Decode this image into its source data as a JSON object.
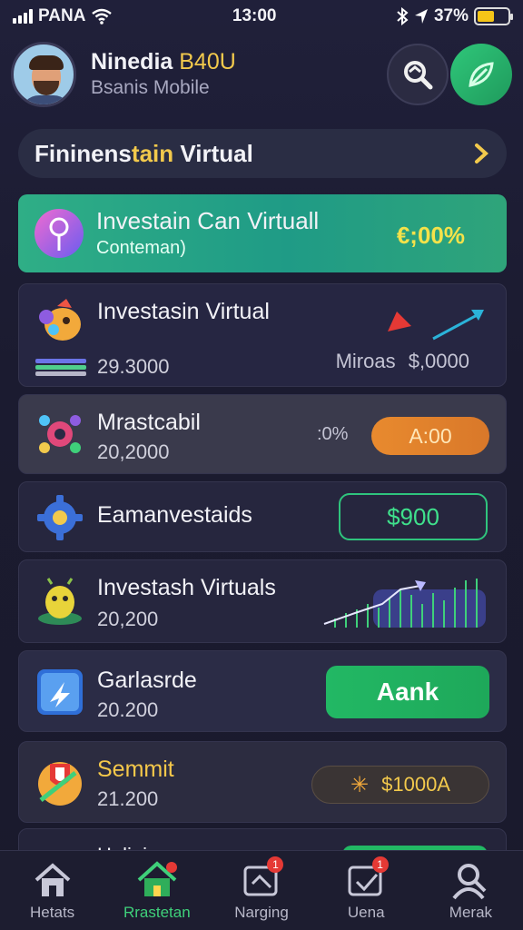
{
  "status_bar": {
    "carrier": "PANA",
    "time": "13:00",
    "battery_percent": "37%",
    "battery_level": 0.55
  },
  "header": {
    "name_main": "Ninedia ",
    "name_highlight": "B40U",
    "subtitle": "Bsanis Mobile"
  },
  "banner": {
    "title_a": "Fininens",
    "title_b": "tain",
    "title_c": " Virtual"
  },
  "cards": {
    "featured": {
      "title": "Investain Can Virtuall",
      "subtitle": "Conteman)",
      "amount": "€;00%"
    },
    "c2": {
      "title": "Investasin Virtual",
      "value": "29.3000",
      "right_label": "Miroas",
      "right_amount": "$,0000"
    },
    "c3": {
      "title": "Mrastcabil",
      "value": "20,2000",
      "percent": ":0%",
      "button": "A:00"
    },
    "c4": {
      "title": "Eamanvestaids",
      "button": "$900"
    },
    "c5": {
      "title": "Investash Virtuals",
      "value": "20,200"
    },
    "c6": {
      "title": "Garlasrde",
      "value": "20.200",
      "button": "Aank"
    },
    "c7": {
      "title": "Semmit",
      "value": "21.200",
      "button": "$1000А"
    },
    "c8": {
      "title": "Halinina"
    }
  },
  "nav": {
    "items": [
      {
        "label": "Hetats",
        "icon": "home-icon",
        "badge": ""
      },
      {
        "label": "Rrastetan",
        "icon": "home-active-icon",
        "badge": ""
      },
      {
        "label": "Narging",
        "icon": "message-icon",
        "badge": "1"
      },
      {
        "label": "Uena",
        "icon": "check-icon",
        "badge": "1"
      },
      {
        "label": "Merak",
        "icon": "person-icon",
        "badge": ""
      }
    ]
  },
  "colors": {
    "accent_green": "#2fc47d",
    "accent_yellow": "#f2c94c",
    "accent_orange": "#e88a2e",
    "background": "#1a1a2e"
  }
}
